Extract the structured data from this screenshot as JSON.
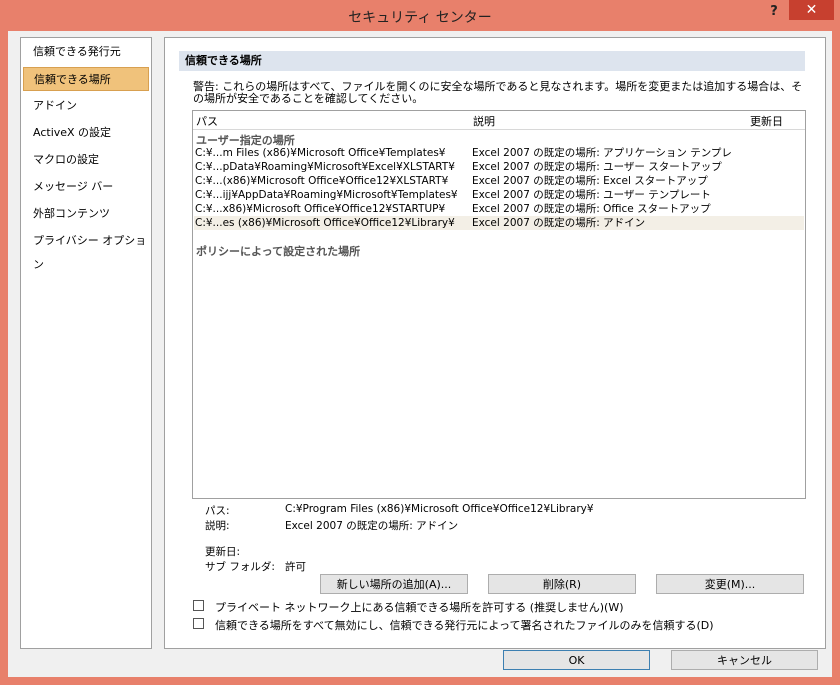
{
  "window": {
    "title": "セキュリティ センター",
    "help": "?",
    "close": "✕"
  },
  "nav": {
    "items": [
      {
        "label": "信頼できる発行元"
      },
      {
        "label": "信頼できる場所"
      },
      {
        "label": "アドイン"
      },
      {
        "label": "ActiveX の設定"
      },
      {
        "label": "マクロの設定"
      },
      {
        "label": "メッセージ バー"
      },
      {
        "label": "外部コンテンツ"
      },
      {
        "label": "プライバシー オプション"
      }
    ],
    "selected_index": 1
  },
  "main": {
    "header": "信頼できる場所",
    "warning": "警告: これらの場所はすべて、ファイルを開くのに安全な場所であると見なされます。場所を変更または追加する場合は、その場所が安全であることを確認してください。",
    "columns": [
      "パス",
      "説明",
      "更新日"
    ],
    "group_user": "ユーザー指定の場所",
    "rows": [
      {
        "path": "C:¥...m Files (x86)¥Microsoft Office¥Templates¥",
        "desc": "Excel 2007 の既定の場所: アプリケーション テンプレ..."
      },
      {
        "path": "C:¥...pData¥Roaming¥Microsoft¥Excel¥XLSTART¥",
        "desc": "Excel 2007 の既定の場所: ユーザー スタートアップ"
      },
      {
        "path": "C:¥...(x86)¥Microsoft Office¥Office12¥XLSTART¥",
        "desc": "Excel 2007 の既定の場所: Excel スタートアップ"
      },
      {
        "path": "C:¥...ijj¥AppData¥Roaming¥Microsoft¥Templates¥",
        "desc": "Excel 2007 の既定の場所: ユーザー テンプレート"
      },
      {
        "path": "C:¥...x86)¥Microsoft Office¥Office12¥STARTUP¥",
        "desc": "Excel 2007 の既定の場所: Office スタートアップ"
      },
      {
        "path": "C:¥...es (x86)¥Microsoft Office¥Office12¥Library¥",
        "desc": "Excel 2007 の既定の場所: アドイン"
      }
    ],
    "selected_row": 5,
    "group_policy": "ポリシーによって設定された場所",
    "details": {
      "path_label": "パス:",
      "path_value": "C:¥Program Files (x86)¥Microsoft Office¥Office12¥Library¥",
      "desc_label": "説明:",
      "desc_value": "Excel 2007 の既定の場所: アドイン",
      "modified_label": "更新日:",
      "modified_value": "",
      "subfolders_label": "サブ フォルダ:",
      "subfolders_value": "許可"
    },
    "buttons": {
      "add": "新しい場所の追加(A)...",
      "delete": "削除(R)",
      "modify": "変更(M)..."
    },
    "checkboxes": [
      {
        "label": "プライベート ネットワーク上にある信頼できる場所を許可する (推奨しません)(W)",
        "checked": false
      },
      {
        "label": "信頼できる場所をすべて無効にし、信頼できる発行元によって署名されたファイルのみを信頼する(D)",
        "checked": false
      }
    ]
  },
  "footer": {
    "ok": "OK",
    "cancel": "キャンセル"
  }
}
